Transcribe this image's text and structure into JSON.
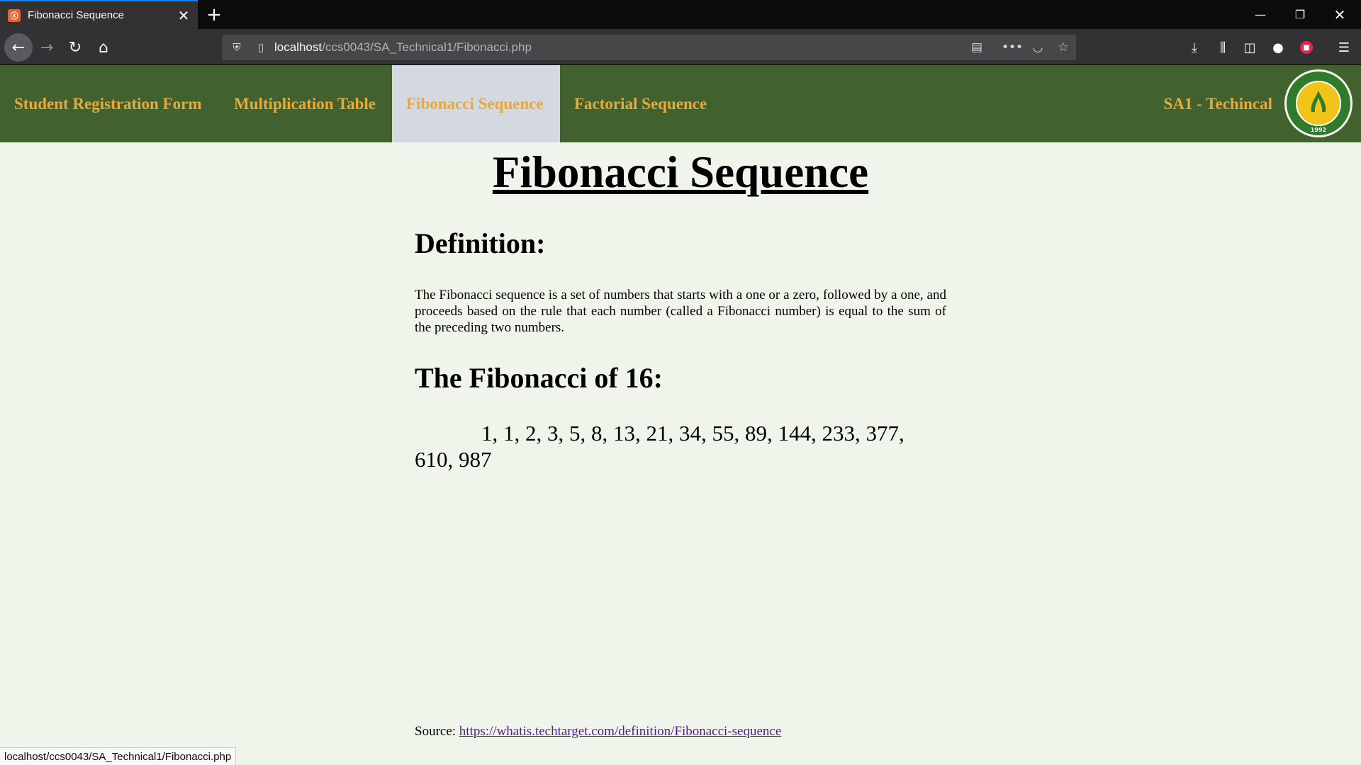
{
  "browser": {
    "tab_title": "Fibonacci Sequence",
    "tab_favicon": "xampp-icon",
    "url_host": "localhost",
    "url_path": "/ccs0043/SA_Technical1/Fibonacci.php",
    "status_url": "localhost/ccs0043/SA_Technical1/Fibonacci.php"
  },
  "nav": {
    "items": [
      {
        "label": "Student Registration Form",
        "active": false
      },
      {
        "label": "Multiplication Table",
        "active": false
      },
      {
        "label": "Fibonacci Sequence",
        "active": true
      },
      {
        "label": "Factorial Sequence",
        "active": false
      }
    ],
    "brand": "SA1 - Techincal",
    "logo_year": "1992"
  },
  "page": {
    "title": "Fibonacci Sequence",
    "definition_heading": "Definition:",
    "definition_text": "The Fibonacci sequence is a set of numbers that starts with a one or a zero, followed by a one, and proceeds based on the rule that each number (called a Fibonacci number) is equal to the sum of the preceding two numbers.",
    "sequence_heading": "The Fibonacci of 16:",
    "sequence": "1, 1, 2, 3, 5, 8, 13, 21, 34, 55, 89, 144, 233, 377, 610, 987",
    "source_label": "Source:",
    "source_link": "https://whatis.techtarget.com/definition/Fibonacci-sequence"
  },
  "colors": {
    "nav_bg": "#41622f",
    "nav_text": "#e8a93a",
    "active_bg": "#d4d8e0",
    "page_bg": "#f0f5ec"
  }
}
